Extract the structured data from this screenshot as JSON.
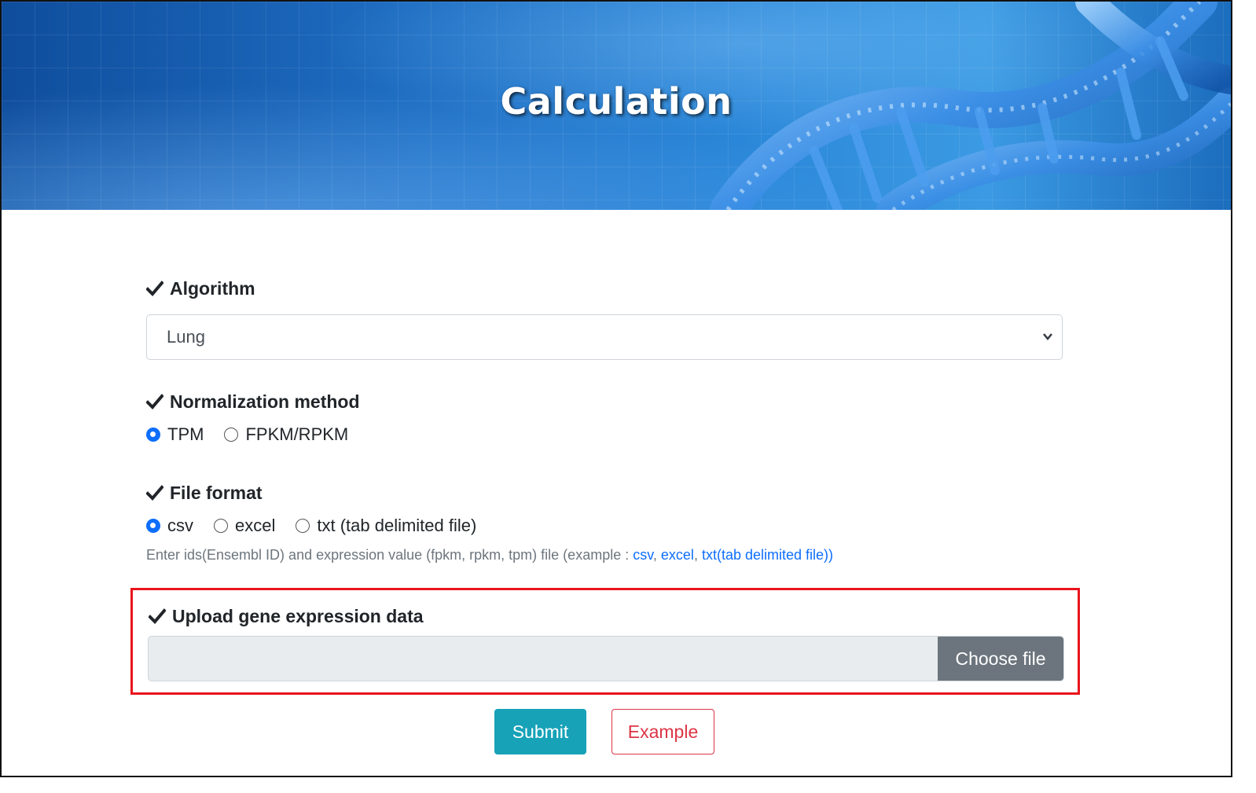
{
  "banner": {
    "title": "Calculation"
  },
  "algorithm": {
    "label": "Algorithm",
    "selected": "Lung"
  },
  "normalization": {
    "label": "Normalization method",
    "options": [
      {
        "label": "TPM",
        "checked": true
      },
      {
        "label": "FPKM/RPKM",
        "checked": false
      }
    ]
  },
  "file_format": {
    "label": "File format",
    "options": [
      {
        "label": "csv",
        "checked": true
      },
      {
        "label": "excel",
        "checked": false
      },
      {
        "label": "txt (tab delimited file)",
        "checked": false
      }
    ],
    "help_prefix": "Enter ids(Ensembl ID) and expression value (fpkm, rpkm, tpm) file (example : ",
    "help_links": [
      "csv",
      "excel",
      "txt(tab delimited file)"
    ],
    "help_suffix": ")"
  },
  "upload": {
    "label": "Upload gene expression data",
    "button": "Choose file"
  },
  "actions": {
    "submit": "Submit",
    "example": "Example"
  },
  "colors": {
    "accent": "#0d6efd",
    "submit": "#17a2b8",
    "example": "#dc3545",
    "highlight_border": "#e8141c"
  }
}
